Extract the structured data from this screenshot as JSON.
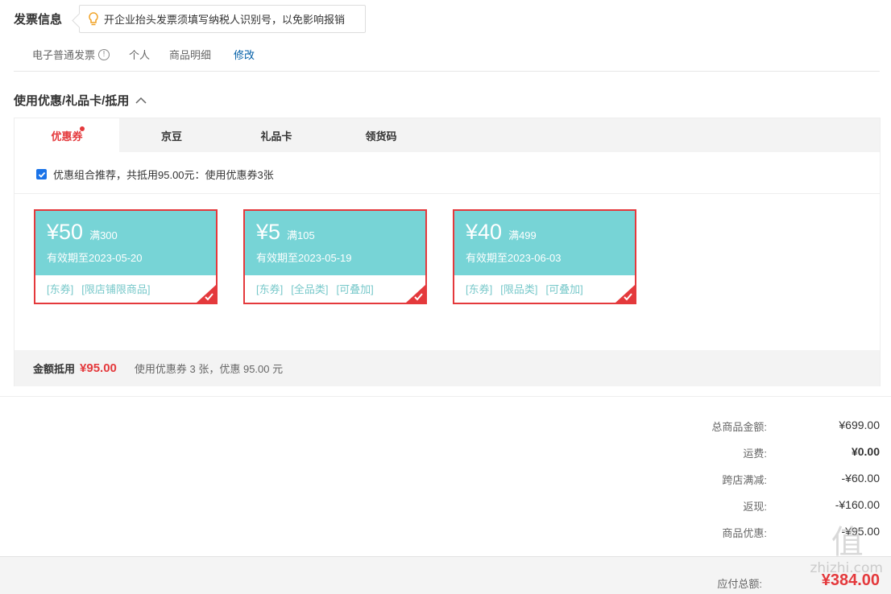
{
  "invoice": {
    "title": "发票信息",
    "tip": "开企业抬头发票须填写纳税人识别号，以免影响报销",
    "type": "电子普通发票",
    "title_type": "个人",
    "content": "商品明细",
    "edit": "修改"
  },
  "coupon_section": {
    "title": "使用优惠/礼品卡/抵用",
    "tabs": [
      {
        "label": "优惠券"
      },
      {
        "label": "京豆"
      },
      {
        "label": "礼品卡"
      },
      {
        "label": "领货码"
      }
    ],
    "recommend_text": "优惠组合推荐，共抵用95.00元：使用优惠券3张",
    "recommend_checked": true,
    "cards": [
      {
        "amount": "¥50",
        "condition": "满300",
        "valid": "有效期至2023-05-20",
        "tags": [
          "[东券]",
          "[限店铺限商品]"
        ]
      },
      {
        "amount": "¥5",
        "condition": "满105",
        "valid": "有效期至2023-05-19",
        "tags": [
          "[东券]",
          "[全品类]",
          "[可叠加]"
        ]
      },
      {
        "amount": "¥40",
        "condition": "满499",
        "valid": "有效期至2023-06-03",
        "tags": [
          "[东券]",
          "[限品类]",
          "[可叠加]"
        ]
      }
    ],
    "summary_label": "金额抵用",
    "summary_amount": "¥95.00",
    "summary_desc": "使用优惠券 3 张，优惠 95.00 元"
  },
  "totals": [
    {
      "label": "总商品金额:",
      "value": "¥699.00"
    },
    {
      "label": "运费:",
      "value": "¥0.00"
    },
    {
      "label": "跨店满减:",
      "value": "-¥60.00"
    },
    {
      "label": "返现:",
      "value": "-¥160.00"
    },
    {
      "label": "商品优惠:",
      "value": "-¥95.00"
    }
  ],
  "footer": {
    "label": "应付总额:",
    "value": "¥384.00"
  },
  "watermark": {
    "logo": "值",
    "site": "zhizhi.com"
  },
  "colors": {
    "accent_red": "#e4393c",
    "coupon_teal": "#77d4d6",
    "link_blue": "#005ea7"
  }
}
